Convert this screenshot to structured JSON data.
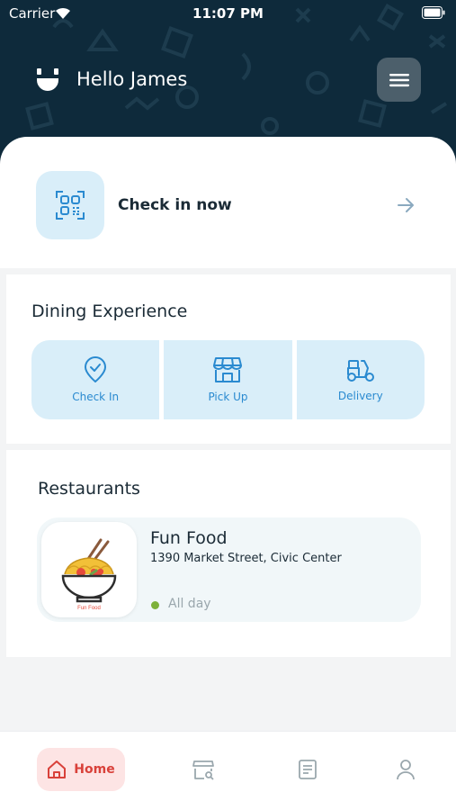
{
  "status_bar": {
    "carrier": "Carrier",
    "time": "11:07 PM"
  },
  "header": {
    "greeting": "Hello James",
    "logo_icon": "smile-logo-icon",
    "menu_icon": "hamburger-icon"
  },
  "check_in": {
    "label": "Check in now",
    "icon": "qr-code-icon",
    "arrow_icon": "arrow-right-icon"
  },
  "dining": {
    "title": "Dining Experience",
    "options": [
      {
        "label": "Check In",
        "icon": "location-check-icon"
      },
      {
        "label": "Pick Up",
        "icon": "storefront-icon"
      },
      {
        "label": "Delivery",
        "icon": "scooter-icon"
      }
    ]
  },
  "restaurants": {
    "title": "Restaurants",
    "items": [
      {
        "name": "Fun Food",
        "address": "1390 Market Street, Civic Center",
        "hours": "All day",
        "logo_text": "Fun Food",
        "status_color": "#7db13a"
      }
    ]
  },
  "tabbar": {
    "home_label": "Home",
    "active_color": "#d9413a",
    "tabs": [
      "home-icon",
      "store-search-icon",
      "receipt-icon",
      "profile-icon"
    ]
  },
  "colors": {
    "header_bg": "#0e2a3b",
    "accent_light": "#d9eef9",
    "accent_blue": "#2a8ad0"
  }
}
